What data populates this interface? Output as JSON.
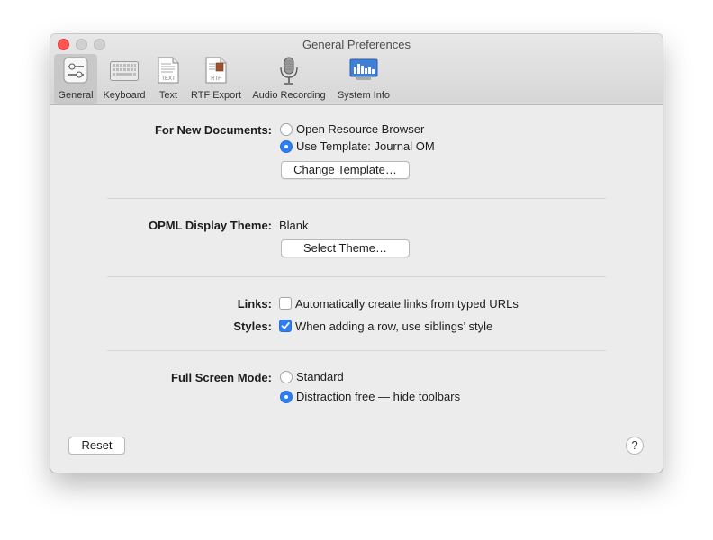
{
  "window": {
    "title": "General Preferences"
  },
  "toolbar": {
    "items": [
      {
        "label": "General",
        "icon": "general-sliders-icon",
        "active": true
      },
      {
        "label": "Keyboard",
        "icon": "keyboard-icon",
        "active": false
      },
      {
        "label": "Text",
        "icon": "text-document-icon",
        "active": false
      },
      {
        "label": "RTF Export",
        "icon": "rtf-document-icon",
        "active": false
      },
      {
        "label": "Audio Recording",
        "icon": "microphone-icon",
        "active": false
      },
      {
        "label": "System Info",
        "icon": "system-info-chart-icon",
        "active": false
      }
    ]
  },
  "new_documents": {
    "label": "For New Documents:",
    "options": [
      {
        "label": "Open Resource Browser",
        "selected": false
      },
      {
        "label": "Use Template: Journal OM",
        "selected": true
      }
    ],
    "button": "Change Template…"
  },
  "opml": {
    "label": "OPML Display Theme:",
    "value": "Blank",
    "button": "Select Theme…"
  },
  "links": {
    "label": "Links:",
    "checkbox_label": "Automatically create links from typed URLs",
    "checked": false
  },
  "styles": {
    "label": "Styles:",
    "checkbox_label": "When adding a row, use siblings’ style",
    "checked": true
  },
  "full_screen": {
    "label": "Full Screen Mode:",
    "options": [
      {
        "label": "Standard",
        "selected": false
      },
      {
        "label": "Distraction free — hide toolbars",
        "selected": true
      }
    ]
  },
  "footer": {
    "reset_label": "Reset",
    "help_label": "?"
  },
  "colors": {
    "accent": "#2d7df6",
    "close_button": "#fc5753",
    "window_bg": "#ececec"
  }
}
